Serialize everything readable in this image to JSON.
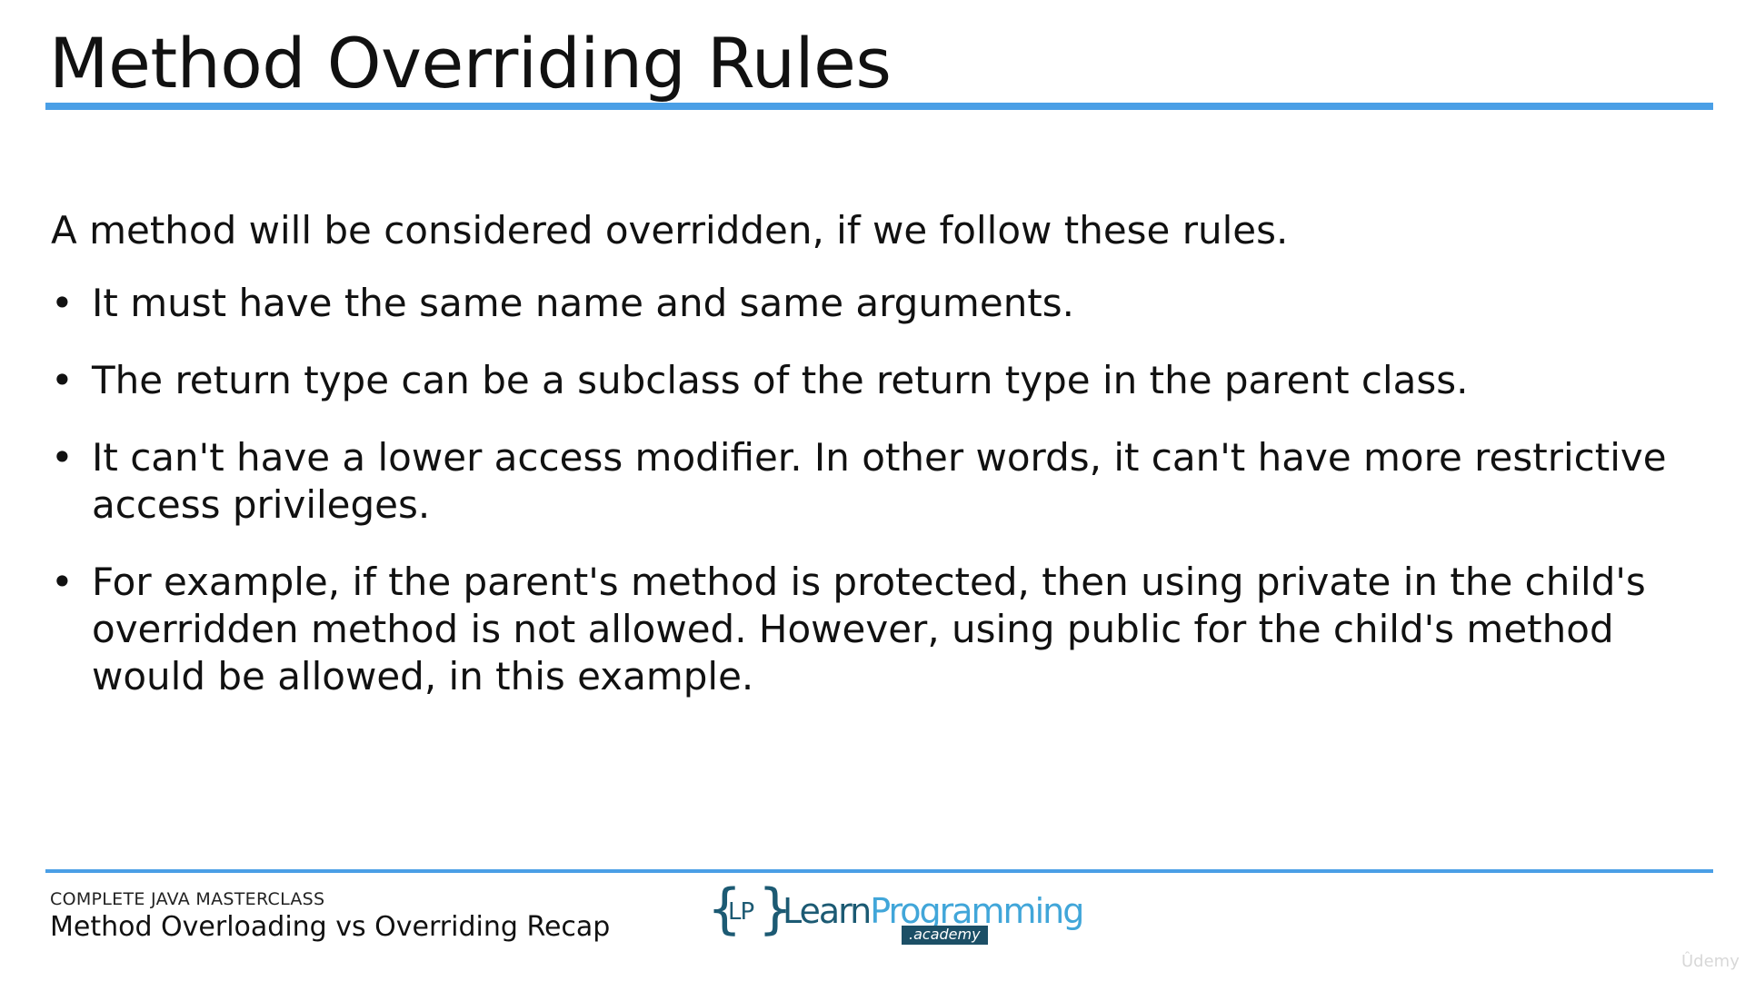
{
  "slide": {
    "title": "Method Overriding Rules",
    "intro": "A method will be considered overridden, if we follow these rules.",
    "bullet_symbol": "•",
    "rules": [
      "It must have the same name and same arguments.",
      "The return type can be a subclass of the return type in the parent class.",
      "It can't have a lower access modifier.  In other words, it can't have more restrictive access privileges.",
      "For example, if the parent's method is protected, then using private in the child's overridden method is not allowed.  However, using public for the child's method would be allowed, in this example."
    ]
  },
  "footer": {
    "course": "COMPLETE JAVA MASTERCLASS",
    "lecture": "Method Overloading vs Overriding Recap"
  },
  "logo": {
    "brace_open": "{",
    "initials": "LP",
    "brace_close": "}",
    "learn": "Learn",
    "programming": "Programming",
    "academy": ".academy"
  },
  "watermark": "Ûdemy",
  "colors": {
    "accent_rule": "#4a9fe6",
    "logo_dark": "#1c5a73",
    "logo_light": "#41a6d9"
  }
}
